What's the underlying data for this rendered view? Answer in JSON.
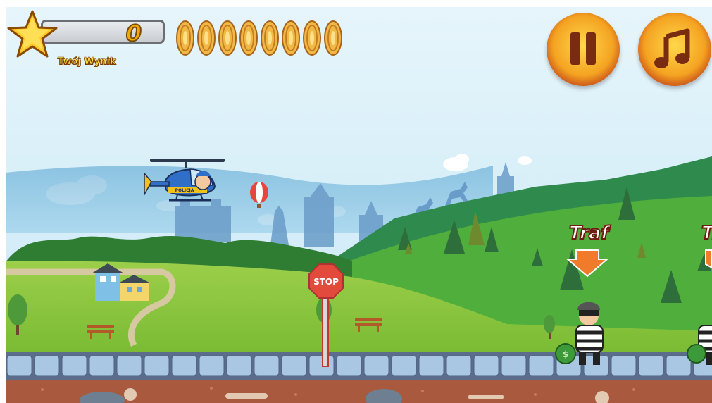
{
  "hud": {
    "score_value": "0",
    "score_label": "Twój Wynik",
    "ammo_count": 8,
    "pause_icon": "pause-icon",
    "music_icon": "music-note-icon"
  },
  "scene": {
    "helicopter_text": "POLICJA",
    "stop_sign_text": "STOP",
    "targets": [
      {
        "label": "Traf"
      },
      {
        "label": "Traf"
      }
    ]
  },
  "colors": {
    "sky_top": "#e9f6fb",
    "sky_bottom": "#c9e9f6",
    "grass": "#8dc63f",
    "grass_dark": "#6fae2e",
    "hill": "#3f9a3a",
    "road": "#8fb7d6",
    "ground": "#a85a3c",
    "accent_orange": "#f4a321",
    "accent_red": "#c23421"
  }
}
